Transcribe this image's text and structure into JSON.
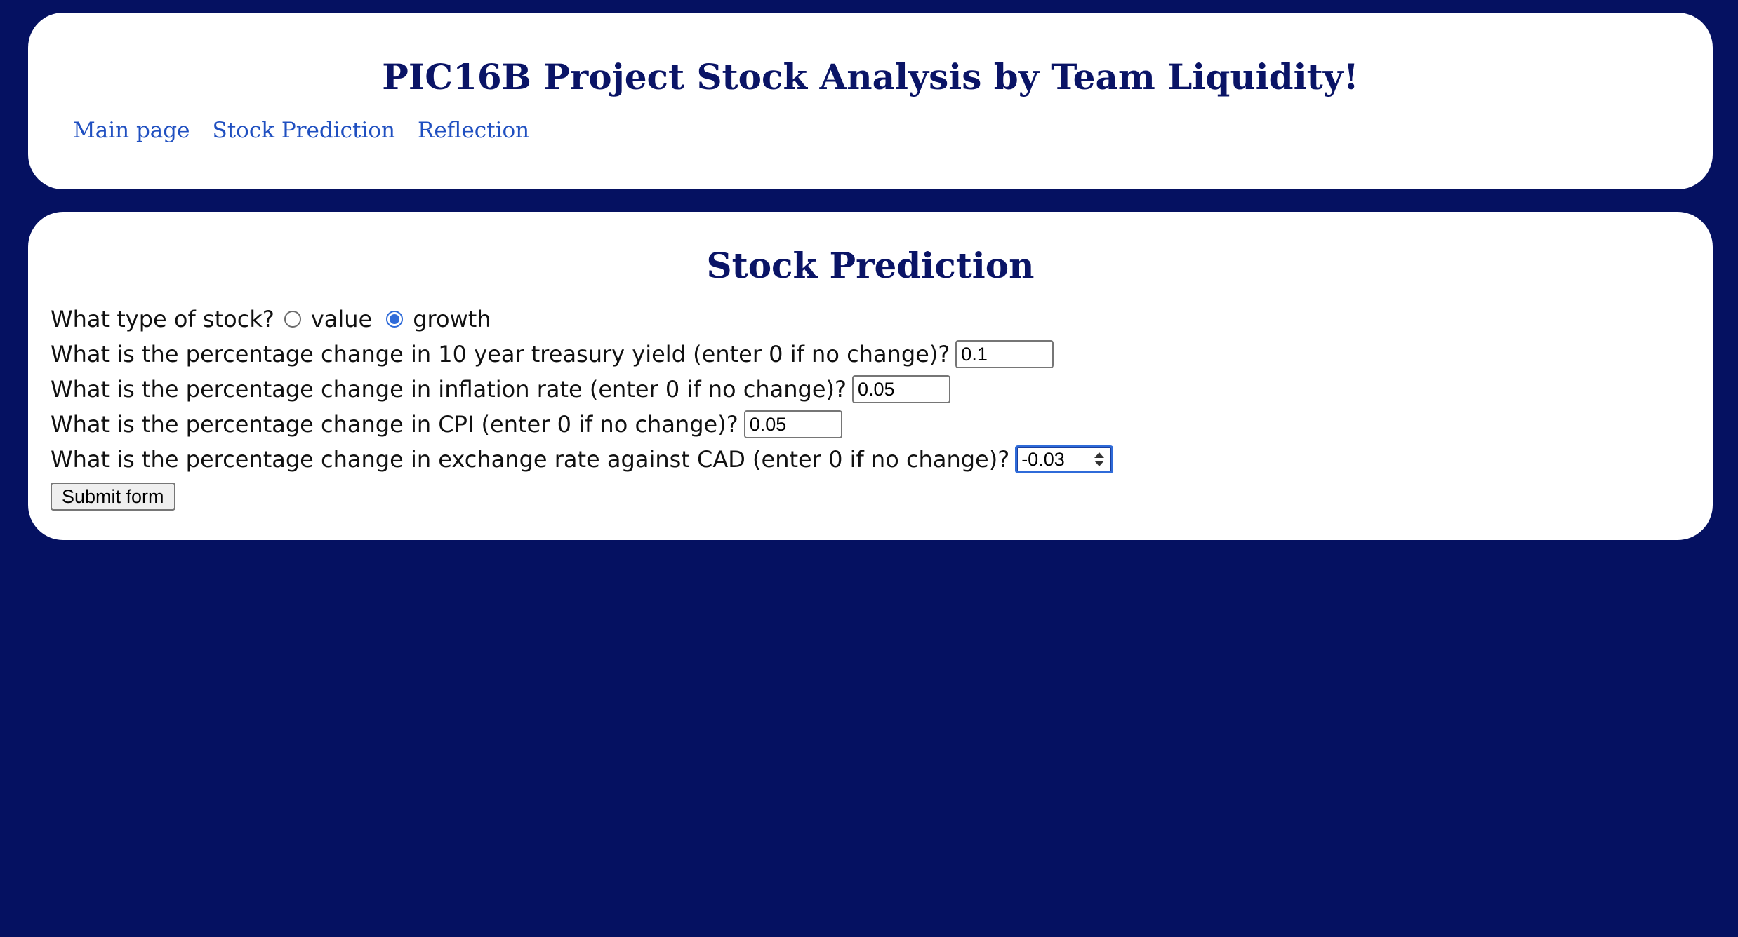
{
  "header": {
    "title": "PIC16B Project Stock Analysis by Team Liquidity!",
    "nav": {
      "main_page": "Main page",
      "stock_prediction": "Stock Prediction",
      "reflection": "Reflection"
    }
  },
  "main": {
    "title": "Stock Prediction",
    "form": {
      "stock_type": {
        "question": "What type of stock?",
        "options": [
          "value",
          "growth"
        ],
        "selected": "growth"
      },
      "treasury": {
        "question": "What is the percentage change in 10 year treasury yield (enter 0 if no change)?",
        "value": "0.1"
      },
      "inflation": {
        "question": "What is the percentage change in inflation rate (enter 0 if no change)?",
        "value": "0.05"
      },
      "cpi": {
        "question": "What is the percentage change in CPI (enter 0 if no change)?",
        "value": "0.05"
      },
      "exchange": {
        "question": "What is the percentage change in exchange rate against CAD (enter 0 if no change)?",
        "value": "-0.03"
      },
      "submit_label": "Submit form"
    }
  },
  "colors": {
    "background": "#051161",
    "panel": "#ffffff",
    "title": "#0a1466",
    "link": "#1f4fc0",
    "radio_accent": "#2f6bd9"
  }
}
